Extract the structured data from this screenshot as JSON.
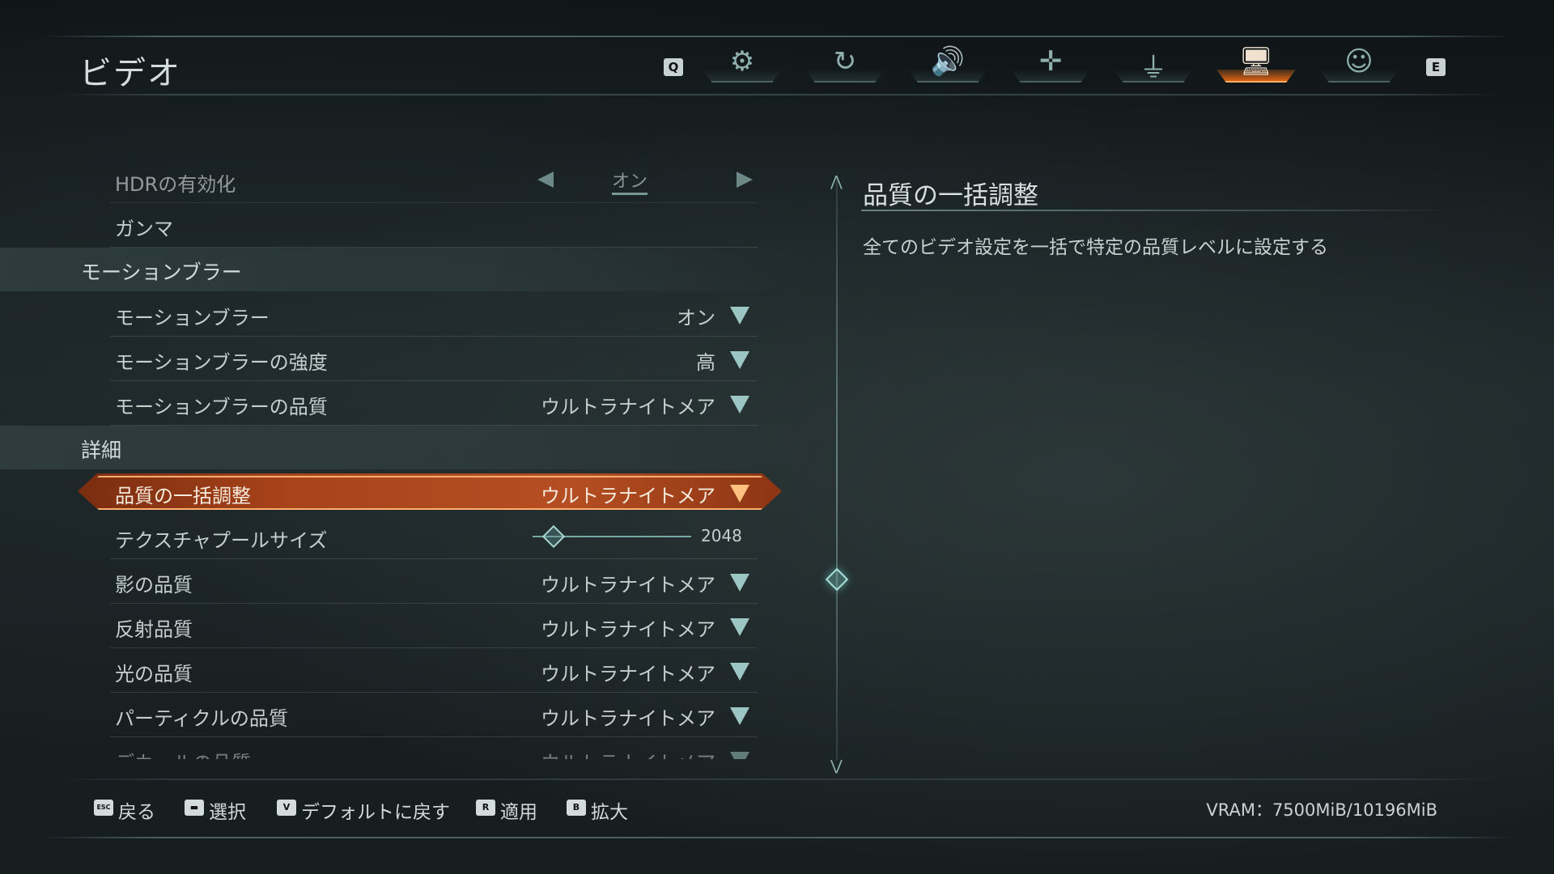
{
  "header": {
    "title": "ビデオ",
    "prev_key": "Q",
    "next_key": "E"
  },
  "tabs": [
    {
      "icon": "gears-icon"
    },
    {
      "icon": "rotate-icon"
    },
    {
      "icon": "speaker-icon"
    },
    {
      "icon": "move-icon"
    },
    {
      "icon": "joystick-icon"
    },
    {
      "icon": "monitor-icon",
      "active": true
    },
    {
      "icon": "accessibility-icon"
    }
  ],
  "rows": {
    "hdr": {
      "label": "HDRの有効化",
      "value": "オン"
    },
    "gamma": {
      "label": "ガンマ"
    },
    "section_motion": "モーションブラー",
    "motion_blur": {
      "label": "モーションブラー",
      "value": "オン"
    },
    "motion_strength": {
      "label": "モーションブラーの強度",
      "value": "高"
    },
    "motion_quality": {
      "label": "モーションブラーの品質",
      "value": "ウルトラナイトメア"
    },
    "section_detail": "詳細",
    "quality_preset": {
      "label": "品質の一括調整",
      "value": "ウルトラナイトメア"
    },
    "texture_pool": {
      "label": "テクスチャプールサイズ",
      "value": "2048"
    },
    "shadow": {
      "label": "影の品質",
      "value": "ウルトラナイトメア"
    },
    "reflection": {
      "label": "反射品質",
      "value": "ウルトラナイトメア"
    },
    "light": {
      "label": "光の品質",
      "value": "ウルトラナイトメア"
    },
    "particle": {
      "label": "パーティクルの品質",
      "value": "ウルトラナイトメア"
    },
    "decal": {
      "label": "デカールの品質",
      "value": "ウルトラナイトメア"
    }
  },
  "description": {
    "title": "品質の一括調整",
    "text": "全てのビデオ設定を一括で特定の品質レベルに設定する"
  },
  "footer": {
    "back": {
      "key": "ESC",
      "label": "戻る"
    },
    "select": {
      "key": "▬",
      "label": "選択"
    },
    "default": {
      "key": "V",
      "label": "デフォルトに戻す"
    },
    "apply": {
      "key": "R",
      "label": "適用"
    },
    "zoom": {
      "key": "B",
      "label": "拡大"
    },
    "vram": "VRAM：7500MiB/10196MiB"
  },
  "colors": {
    "accent": "#ff8a2a",
    "teal": "#9cc6c3"
  }
}
